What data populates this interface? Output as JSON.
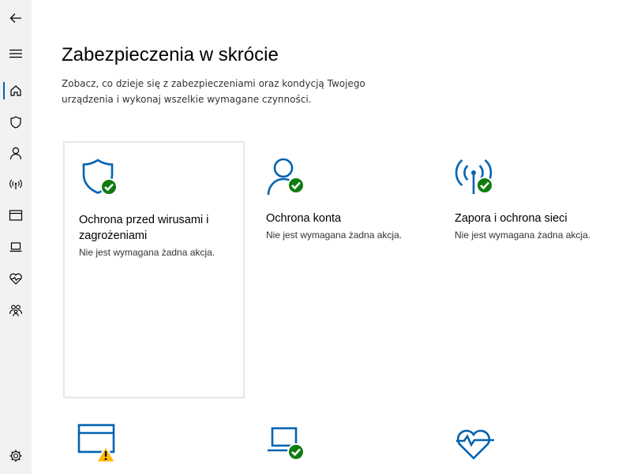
{
  "colors": {
    "accent": "#0063b1",
    "ok_green": "#107c10",
    "warning_yellow": "#ffb900",
    "sidebar_bg": "#f2f2f2"
  },
  "sidebar": {
    "items": [
      {
        "icon": "back-arrow-icon"
      },
      {
        "icon": "hamburger-menu-icon"
      },
      {
        "icon": "home-icon",
        "active": true
      },
      {
        "icon": "shield-icon"
      },
      {
        "icon": "person-icon"
      },
      {
        "icon": "wireless-antenna-icon"
      },
      {
        "icon": "browser-window-icon"
      },
      {
        "icon": "laptop-icon"
      },
      {
        "icon": "heart-pulse-icon"
      },
      {
        "icon": "family-icon"
      },
      {
        "icon": "gear-icon"
      }
    ]
  },
  "header": {
    "title": "Zabezpieczenia w skrócie",
    "description": "Zobacz, co dzieje się z zabezpieczeniami oraz kondycją Twojego urządzenia i wykonaj wszelkie wymagane czynności."
  },
  "tiles": [
    {
      "title": "Ochrona przed wirusami i zagrożeniami",
      "status": "Nie jest wymagana żadna akcja.",
      "icon": "shield-check-icon"
    },
    {
      "title": "Ochrona konta",
      "status": "Nie jest wymagana żadna akcja.",
      "icon": "account-check-icon"
    },
    {
      "title": "Zapora i ochrona sieci",
      "status": "Nie jest wymagana żadna akcja.",
      "icon": "antenna-check-icon"
    }
  ],
  "bottom_tiles": [
    {
      "icon": "app-browser-warning-icon"
    },
    {
      "icon": "device-security-check-icon"
    },
    {
      "icon": "device-health-icon"
    }
  ]
}
